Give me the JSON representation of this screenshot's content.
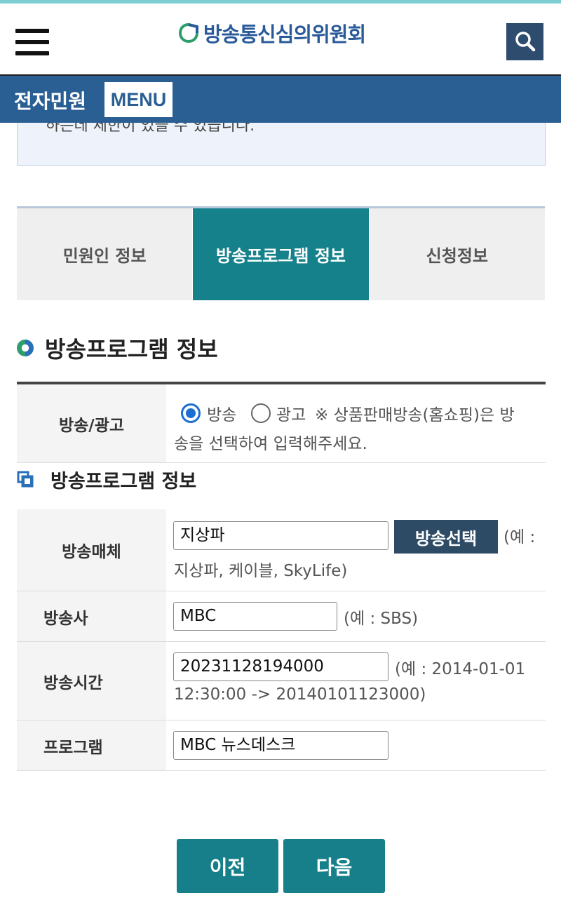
{
  "header": {
    "logo_text": "방송통신심의위원회"
  },
  "navbar": {
    "title": "전자민원",
    "menu_label": "MENU"
  },
  "notice": {
    "text": "하는데 제한이 있을 수 있습니다."
  },
  "tabs": [
    {
      "label": "민원인 정보",
      "active": false
    },
    {
      "label": "방송프로그램 정보",
      "active": true
    },
    {
      "label": "신청정보",
      "active": false
    }
  ],
  "section": {
    "title": "방송프로그램 정보"
  },
  "broadcast_ad": {
    "label": "방송/광고",
    "option_broadcast": "방송",
    "option_ad": "광고",
    "selected": "방송",
    "note_line1": "※ 상품판매방송(홈쇼핑)은 방",
    "note_line2": "송을 선택하여 입력해주세요."
  },
  "subsection": {
    "title": "방송프로그램 정보"
  },
  "fields": {
    "media": {
      "label": "방송매체",
      "value": "지상파",
      "button_label": "방송선택",
      "hint_line1": "(예 :",
      "hint_line2": "지상파, 케이블, SkyLife)"
    },
    "station": {
      "label": "방송사",
      "value": "MBC",
      "hint": "(예 : SBS)"
    },
    "time": {
      "label": "방송시간",
      "value": "20231128194000",
      "hint_line1": "(예 : 2014-01-01",
      "hint_line2": "12:30:00 -> 20140101123000)"
    },
    "program": {
      "label": "프로그램",
      "value": "MBC 뉴스데스크"
    }
  },
  "buttons": {
    "prev": "이전",
    "next": "다음"
  },
  "colors": {
    "accent_teal": "#15818b",
    "nav_blue": "#2a5f94",
    "dark_button": "#2e4b66"
  }
}
